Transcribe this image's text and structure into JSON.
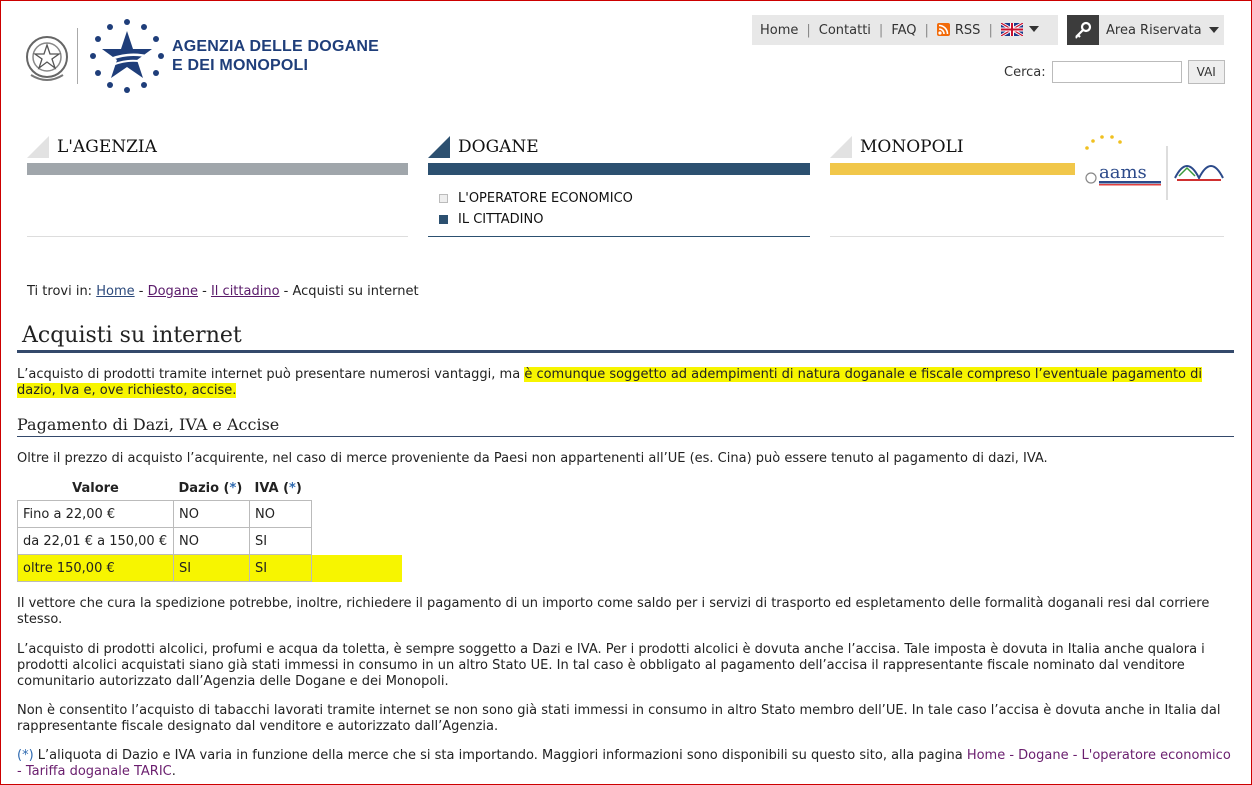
{
  "header": {
    "logo_line1": "AGENZIA DELLE DOGANE",
    "logo_line2": "E DEI MONOPOLI",
    "links": [
      "Home",
      "Contatti",
      "FAQ",
      "RSS"
    ],
    "reserved_area": "Area Riservata",
    "search_label": "Cerca:",
    "search_placeholder": "",
    "search_button": "VAI"
  },
  "sections": {
    "agenzia": "L'AGENZIA",
    "dogane": "DOGANE",
    "monopoli": "MONOPOLI",
    "dogane_items": [
      "L'OPERATORE ECONOMICO",
      "IL CITTADINO"
    ]
  },
  "colors": {
    "agenzia": "#a0a6ab",
    "dogane": "#2c5070",
    "monopoli": "#f1c74a",
    "highlight": "#f7f500"
  },
  "breadcrumb": {
    "prefix": "Ti trovi in:",
    "home": "Home",
    "dogane": "Dogane",
    "cittadino": "Il cittadino",
    "current": "Acquisti su internet"
  },
  "page": {
    "title": "Acquisti su internet",
    "intro_a": "L’acquisto di prodotti tramite internet può presentare numerosi vantaggi, ma ",
    "intro_hl1": "è comunque soggetto ad adempimenti di natura doganale e fiscale compreso l’eventuale pagamento di",
    "intro_hl2": "dazio, Iva e, ove richiesto, accise.",
    "section_title": "Pagamento di Dazi, IVA e Accise",
    "section_intro": "Oltre il prezzo di acquisto l’acquirente, nel caso di merce proveniente da Paesi non appartenenti all’UE (es. Cina) può essere tenuto al pagamento di dazi, IVA.",
    "p_vettore": "Il vettore che cura la spedizione potrebbe, inoltre, richiedere il pagamento di un importo come saldo per i servizi di trasporto ed espletamento delle formalità doganali resi dal corriere stesso.",
    "p_alcolici": "L’acquisto di prodotti alcolici, profumi e acqua da toletta, è sempre soggetto a Dazi e IVA. Per i prodotti alcolici è dovuta anche l’accisa. Tale imposta è dovuta in Italia anche qualora i prodotti alcolici acquistati siano già stati immessi in consumo in un altro Stato UE. In tal caso è obbligato al pagamento dell’accisa il rappresentante fiscale nominato dal venditore comunitario autorizzato dall’Agenzia delle Dogane e dei Monopoli.",
    "p_tabacchi": "Non è consentito l’acquisto di tabacchi lavorati tramite internet se non sono già stati immessi in consumo in altro Stato membro dell’UE. In tale caso l’accisa è dovuta anche in Italia dal rappresentante fiscale designato dal venditore e autorizzato dall’Agenzia.",
    "note_ast": "(*)",
    "note_text": " L’aliquota di Dazio e IVA varia in funzione della merce che si sta importando. Maggiori informazioni sono disponibili su questo sito, alla pagina ",
    "note_link": "Home - Dogane - L'operatore economico - Tariffa doganale TARIC",
    "note_end": "."
  },
  "table": {
    "headers": [
      "Valore",
      "Dazio",
      "IVA"
    ],
    "ast": "*",
    "rows": [
      [
        "Fino a 22,00 €",
        "NO",
        "NO"
      ],
      [
        "da 22,01 € a 150,00 €",
        "NO",
        "SI"
      ],
      [
        "oltre 150,00 €",
        "SI",
        "SI"
      ]
    ]
  }
}
